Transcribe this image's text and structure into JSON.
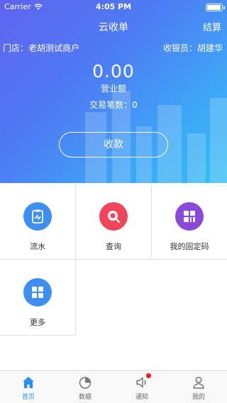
{
  "status_bar": {
    "carrier": "Carrier",
    "time": "4:05 PM"
  },
  "nav": {
    "title": "云收单",
    "right_action": "结算"
  },
  "store": {
    "store_label": "门店：老胡测试商户",
    "cashier_label": "收银员：胡建华"
  },
  "summary": {
    "amount": "0.00",
    "amount_label": "营业额",
    "transactions": "交易笔数：0"
  },
  "collect_button": "收款",
  "grid": [
    {
      "label": "流水",
      "icon": "transaction-log-icon",
      "color": "#3d8ff2"
    },
    {
      "label": "查询",
      "icon": "search-icon",
      "color": "#f0455a"
    },
    {
      "label": "我的固定码",
      "icon": "fixed-code-icon",
      "color": "#8a49d8"
    },
    {
      "label": "更多",
      "icon": "more-icon",
      "color": "#3d8ff2"
    }
  ],
  "tabs": [
    {
      "label": "首页",
      "icon": "home-icon",
      "active": true
    },
    {
      "label": "数据",
      "icon": "pie-chart-icon",
      "active": false
    },
    {
      "label": "通知",
      "icon": "speaker-icon",
      "active": false
    },
    {
      "label": "我的",
      "icon": "user-icon",
      "active": false
    }
  ],
  "colors": {
    "accent": "#2d8ef0",
    "gradient_start": "#5f63f0",
    "gradient_end": "#37c0f4",
    "notify_dot": "#f01b1b"
  }
}
